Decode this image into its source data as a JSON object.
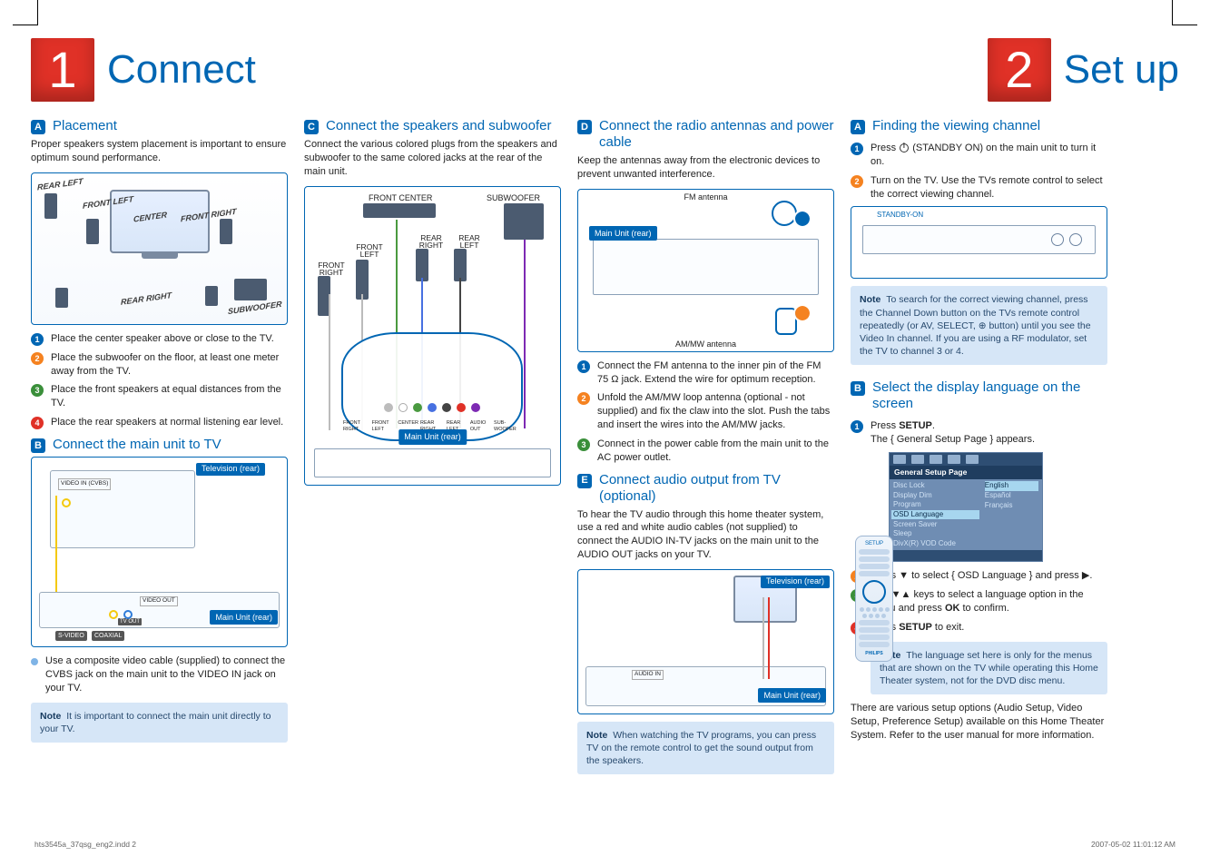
{
  "header": {
    "num1": "1",
    "title1": "Connect",
    "num2": "2",
    "title2": "Set up"
  },
  "col1": {
    "A": {
      "badge": "A",
      "title": "Placement",
      "lead": "Proper speakers system placement is important to ensure optimum sound performance.",
      "labels": {
        "rl": "REAR LEFT",
        "fl": "FRONT LEFT",
        "ctr": "CENTER",
        "fr": "FRONT RIGHT",
        "rr": "REAR RIGHT",
        "sub": "SUBWOOFER"
      },
      "steps": [
        "Place the center speaker above or close to the TV.",
        "Place the subwoofer on the floor, at least one meter away from the TV.",
        "Place the front speakers at equal distances from the TV.",
        "Place the rear speakers at normal listening ear level."
      ]
    },
    "B": {
      "badge": "B",
      "title": "Connect the main unit to TV",
      "tvLabel": "Television (rear)",
      "unitLabel": "Main Unit (rear)",
      "svideo": "S-VIDEO",
      "coaxial": "COAXIAL",
      "videoin": "VIDEO IN (CVBS)",
      "videoout": "VIDEO OUT",
      "tvout": "TV OUT",
      "bullet": "Use a composite video cable (supplied) to connect the CVBS jack on the main unit to the VIDEO IN jack on your TV.",
      "note": "It is important to connect the main unit directly to your TV."
    }
  },
  "col2": {
    "C": {
      "badge": "C",
      "title": "Connect the speakers and subwoofer",
      "lead": "Connect the various colored plugs from the speakers and subwoofer to the same colored jacks at the rear of the main unit.",
      "labels": {
        "fc": "FRONT CENTER",
        "sub": "SUBWOOFER",
        "fl": "FRONT LEFT",
        "fr": "FRONT RIGHT",
        "rl": "REAR LEFT",
        "rr": "REAR RIGHT",
        "unit": "Main Unit (rear)"
      },
      "socketRow": [
        "FRONT RIGHT",
        "FRONT LEFT",
        "CENTER",
        "REAR RIGHT",
        "REAR LEFT",
        "AUDIO OUT",
        "SUB-WOOFER"
      ]
    }
  },
  "col3": {
    "D": {
      "badge": "D",
      "title": "Connect the radio antennas and power cable",
      "lead": "Keep the antennas away from the electronic devices to prevent unwanted interference.",
      "fm": "FM antenna",
      "am": "AM/MW antenna",
      "unit": "Main Unit (rear)",
      "steps": [
        "Connect the FM antenna to the inner pin of the FM 75 Ω jack. Extend the wire for optimum reception.",
        "Unfold the AM/MW loop antenna (optional - not supplied) and fix the claw into the slot. Push the tabs and insert the wires into the AM/MW jacks.",
        "Connect in the power cable from the main unit to the AC power outlet."
      ]
    },
    "E": {
      "badge": "E",
      "title": "Connect audio output from TV (optional)",
      "lead": "To hear the TV audio through this home theater system, use a red and white audio cables (not supplied) to connect the AUDIO IN-TV jacks on the main unit to the AUDIO OUT jacks on your TV.",
      "tvLabel": "Television (rear)",
      "unitLabel": "Main Unit (rear)",
      "audioin": "AUDIO IN",
      "noteStrong": "TV",
      "note": "When watching the TV programs, you can press TV on the remote control to get the sound output from the speakers."
    }
  },
  "col4": {
    "A": {
      "badge": "A",
      "title": "Finding the viewing channel",
      "s1a": "Press ",
      "s1b": " (STANDBY ON) on the main unit to turn it on.",
      "s2": "Turn on the TV. Use the TVs remote control to select the correct viewing channel.",
      "standby": "STANDBY-ON",
      "note": "To search for the correct viewing channel, press the Channel Down button on the TVs remote control repeatedly (or AV, SELECT, ⊕ button) until you see the Video In channel. If you are using a RF modulator, set the TV to channel 3 or 4."
    },
    "B": {
      "badge": "B",
      "title": "Select the display language on the screen",
      "s1a": "Press ",
      "s1b": "SETUP",
      "s1c": ".",
      "s1d": "The { General Setup Page } appears.",
      "osd": {
        "title": "General Setup Page",
        "left": [
          "Disc Lock",
          "Display Dim",
          "Program",
          "OSD Language",
          "Screen Saver",
          "Sleep",
          "DivX(R) VOD Code"
        ],
        "right": [
          "English",
          "Español",
          "Français"
        ],
        "leftSel": "OSD Language",
        "rightSel": "English"
      },
      "s2": "Press ▼ to select { OSD Language } and press ▶.",
      "s3a": "Use ▼▲ keys to select a language option in the menu and press ",
      "s3b": "OK",
      "s3c": " to confirm.",
      "s4a": "Press ",
      "s4b": "SETUP",
      "s4c": " to exit.",
      "note": "The language set here is only for the menus that are shown on the TV while operating this Home Theater system, not for the DVD disc menu.",
      "tail": "There are various setup options (Audio Setup, Video Setup, Preference Setup) available on this Home Theater System. Refer to the user manual for more information."
    },
    "remote": {
      "setup": "SETUP",
      "brand": "PHILIPS"
    }
  },
  "footer": {
    "left": "hts3545a_37qsg_eng2.indd   2",
    "right": "2007-05-02   11:01:12 AM"
  }
}
